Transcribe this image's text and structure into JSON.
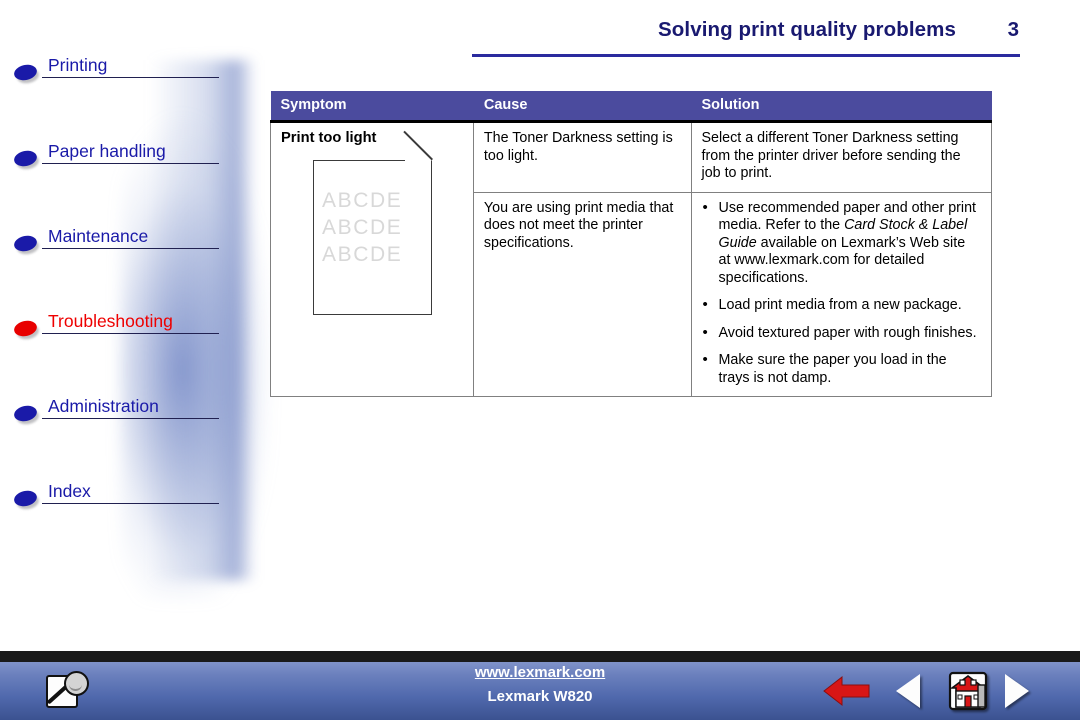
{
  "sidebar": {
    "items": [
      {
        "label": "Printing",
        "active": false,
        "bullet_color": "#1a1aa8"
      },
      {
        "label": "Paper handling",
        "active": false,
        "bullet_color": "#1a1aa8"
      },
      {
        "label": "Maintenance",
        "active": false,
        "bullet_color": "#1a1aa8"
      },
      {
        "label": "Troubleshooting",
        "active": true,
        "bullet_color": "#e80000"
      },
      {
        "label": "Administration",
        "active": false,
        "bullet_color": "#1a1aa8"
      },
      {
        "label": "Index",
        "active": false,
        "bullet_color": "#1a1aa8"
      }
    ]
  },
  "header": {
    "title": "Solving print quality problems",
    "page_number": "3",
    "color": "#191970"
  },
  "table": {
    "header_bg": "#4b4b9e",
    "columns": [
      "Symptom",
      "Cause",
      "Solution"
    ],
    "symptom": {
      "title": "Print too light",
      "illustration_text_lines": [
        "ABCDE",
        "ABCDE",
        "ABCDE"
      ]
    },
    "rows": [
      {
        "cause": "The Toner Darkness setting is too light.",
        "solution_paragraph": "Select a different Toner Darkness setting from the printer driver before sending the job to print."
      },
      {
        "cause": "You are using print media that does not meet the printer specifications.",
        "solution_bullets": [
          {
            "pre": "Use recommended paper and other print media. Refer to the ",
            "italic": "Card Stock & Label Guide",
            "post": " available on Lexmark’s Web site at www.lexmark.com for detailed specifications."
          },
          {
            "pre": "Load print media from a new package.",
            "italic": "",
            "post": ""
          },
          {
            "pre": "Avoid textured paper with rough finishes.",
            "italic": "",
            "post": ""
          },
          {
            "pre": "Make sure the paper you load in the trays is not damp.",
            "italic": "",
            "post": ""
          }
        ]
      }
    ]
  },
  "footer": {
    "url": "www.lexmark.com",
    "model": "Lexmark W820",
    "icons": {
      "search": "search-page-icon",
      "back": "red-back-arrow-icon",
      "previous": "previous-page-icon",
      "home": "home-house-icon",
      "next": "next-page-icon"
    }
  }
}
